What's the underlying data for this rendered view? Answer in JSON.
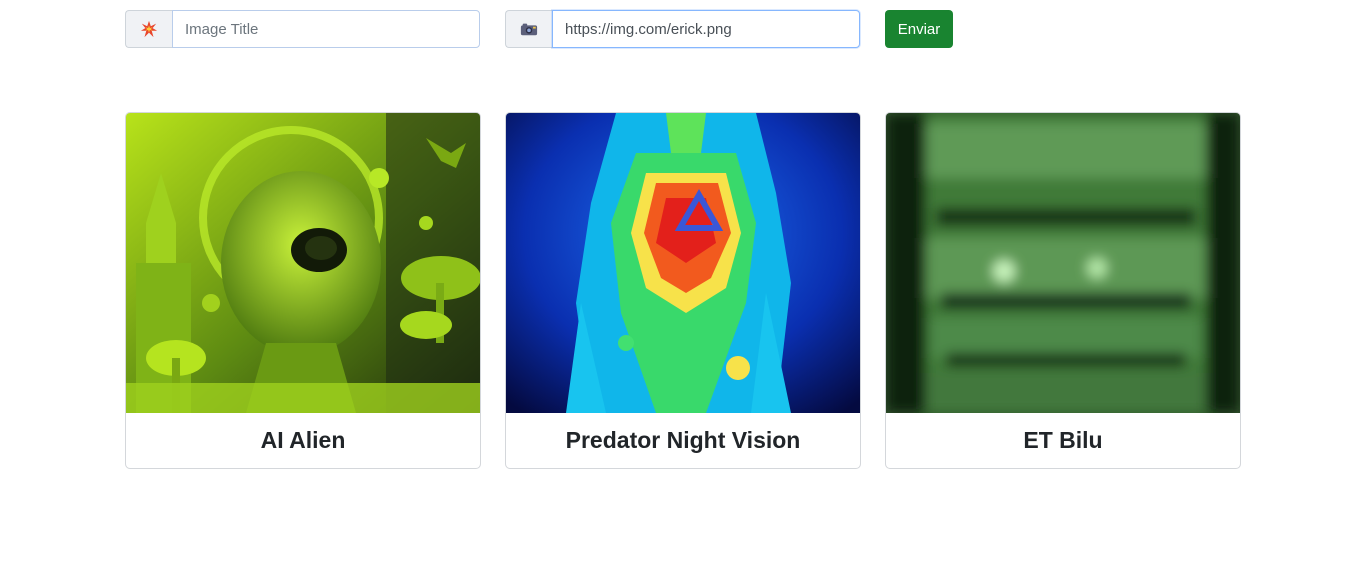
{
  "form": {
    "title_placeholder": "Image Title",
    "title_value": "",
    "title_icon": "collision-icon",
    "url_value": "https://img.com/erick.png",
    "url_icon": "camera-icon",
    "submit_label": "Enviar"
  },
  "colors": {
    "submit_bg": "#198430",
    "card_border": "#d4d7db"
  },
  "cards": [
    {
      "title": "AI Alien",
      "image_subject": "green-alien-artwork"
    },
    {
      "title": "Predator Night Vision",
      "image_subject": "predator-thermal-image"
    },
    {
      "title": "ET Bilu",
      "image_subject": "green-night-vision-face"
    }
  ]
}
